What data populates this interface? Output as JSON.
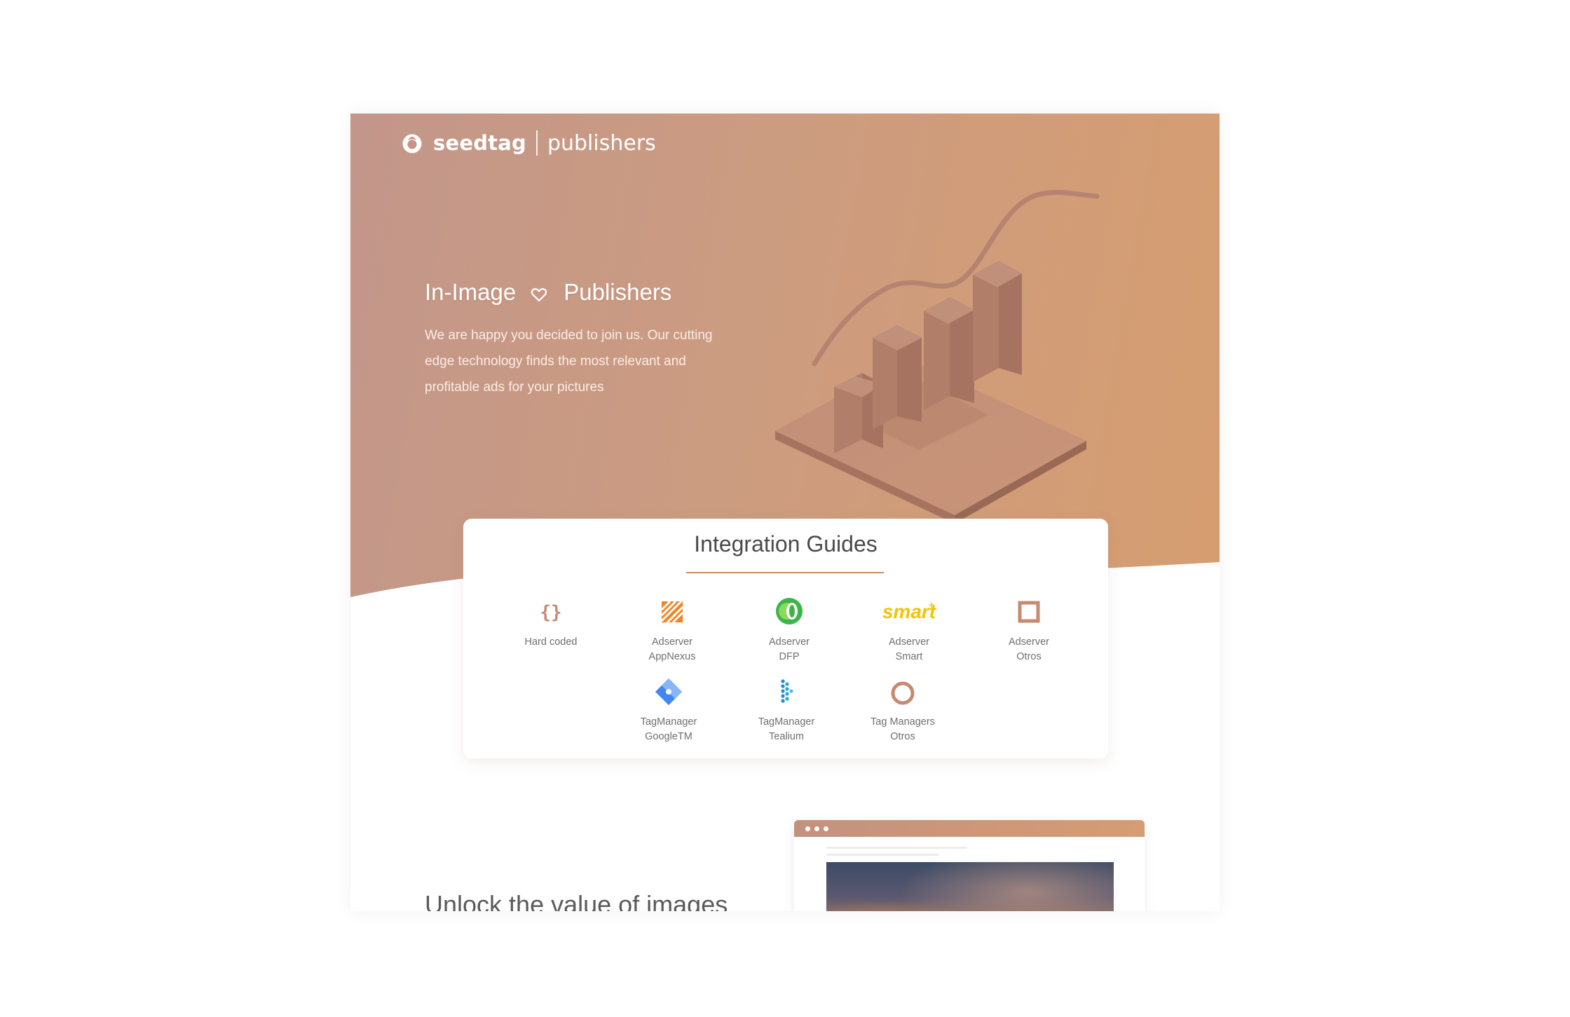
{
  "header": {
    "brand_name": "seedtag",
    "section_name": "publishers"
  },
  "hero": {
    "title_left": "In-Image",
    "title_right": "Publishers",
    "heart_icon": "heart-icon",
    "description": "We are happy you decided to join us. Our cutting edge technology finds the most relevant and profitable ads for your pictures"
  },
  "integration": {
    "title": "Integration Guides",
    "guides": [
      {
        "label": "Hard coded",
        "icon": "code-braces-icon"
      },
      {
        "label": "Adserver\nAppNexus",
        "icon": "appnexus-icon"
      },
      {
        "label": "Adserver\nDFP",
        "icon": "dfp-icon"
      },
      {
        "label": "Adserver\nSmart",
        "icon": "smart-icon"
      },
      {
        "label": "Adserver\nOtros",
        "icon": "square-outline-icon"
      },
      {
        "label": "TagManager\nGoogleTM",
        "icon": "google-tag-manager-icon"
      },
      {
        "label": "TagManager\nTealium",
        "icon": "tealium-icon"
      },
      {
        "label": "Tag Managers\nOtros",
        "icon": "circle-outline-icon"
      }
    ]
  },
  "unlock": {
    "title": "Unlock the value of images"
  },
  "colors": {
    "hero_gradient_start": "#c2968a",
    "hero_gradient_end": "#d69d70",
    "accent": "#c58b72",
    "smart_yellow": "#f4c400",
    "appnexus_orange": "#f58220",
    "dfp_green": "#3bb54a"
  }
}
